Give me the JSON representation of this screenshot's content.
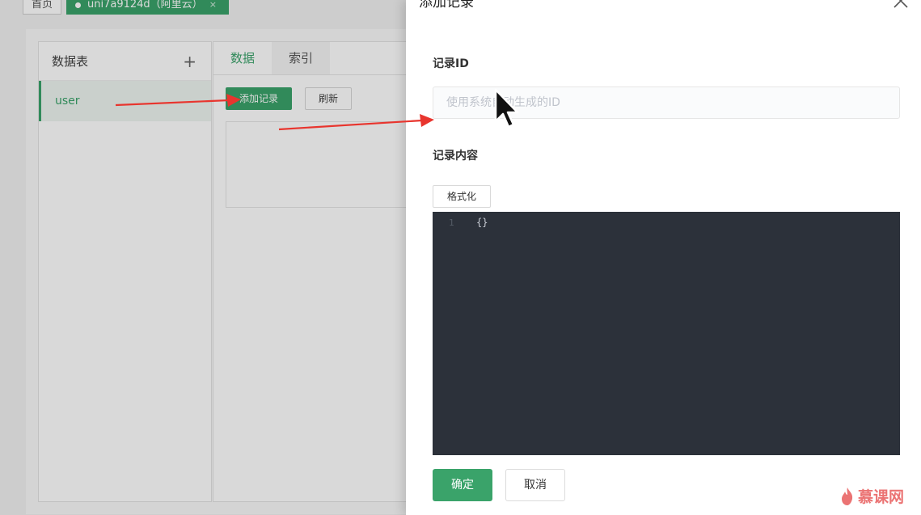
{
  "top_tabs": {
    "home_label": "首页",
    "space_label": "uni7a9124d（阿里云）",
    "space_close": "×"
  },
  "tables_panel": {
    "title": "数据表",
    "add_symbol": "+",
    "items": [
      {
        "label": "user"
      }
    ]
  },
  "content_panel": {
    "tabs": [
      {
        "label": "数据"
      },
      {
        "label": "索引"
      }
    ],
    "add_record_label": "添加记录",
    "refresh_label": "刷新"
  },
  "drawer": {
    "title": "添加记录",
    "record_id_label": "记录ID",
    "record_id_placeholder": "使用系统自动生成的ID",
    "record_content_label": "记录内容",
    "format_label": "格式化",
    "editor": {
      "line_number": "1",
      "code": "{}"
    },
    "confirm_label": "确定",
    "cancel_label": "取消"
  },
  "watermark": {
    "text": "慕课网"
  },
  "colors": {
    "accent": "#3aa36a",
    "editor_bg": "#2c313a",
    "arrow": "#e8352e"
  },
  "icons": {
    "close": "close-icon",
    "add": "plus-icon",
    "cursor": "cursor-icon",
    "watermark": "flame-icon"
  }
}
